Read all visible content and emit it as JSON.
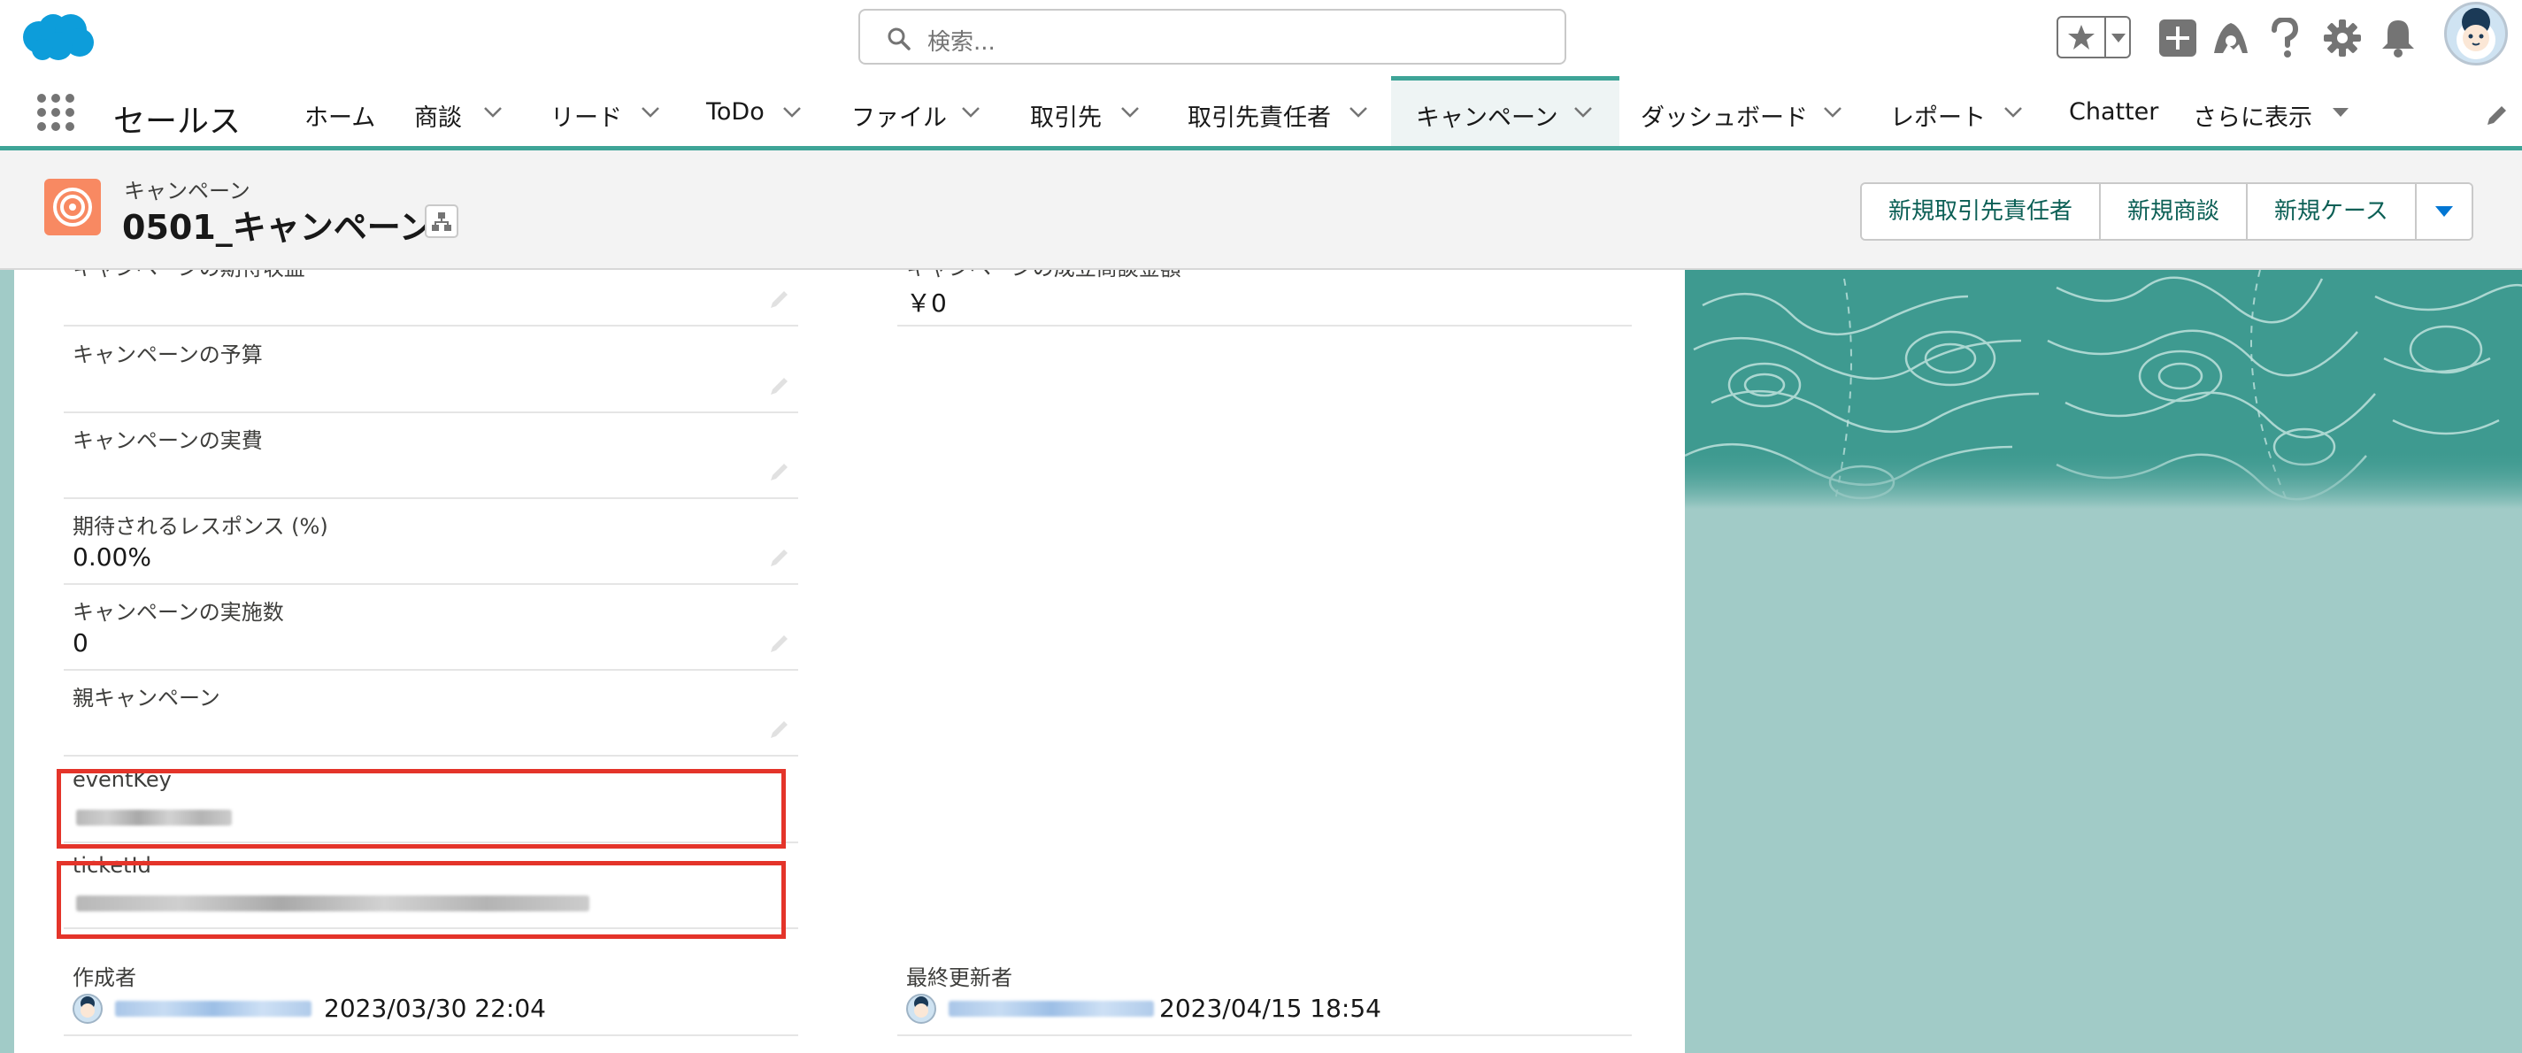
{
  "search": {
    "placeholder": "検索..."
  },
  "nav": {
    "app_name": "セールス",
    "tabs": [
      {
        "label": "ホーム",
        "has_menu": false
      },
      {
        "label": "商談",
        "has_menu": true
      },
      {
        "label": "リード",
        "has_menu": true
      },
      {
        "label": "ToDo",
        "has_menu": true
      },
      {
        "label": "ファイル",
        "has_menu": true
      },
      {
        "label": "取引先",
        "has_menu": true
      },
      {
        "label": "取引先責任者",
        "has_menu": true
      },
      {
        "label": "キャンペーン",
        "has_menu": true,
        "active": true
      },
      {
        "label": "ダッシュボード",
        "has_menu": true
      },
      {
        "label": "レポート",
        "has_menu": true
      },
      {
        "label": "Chatter",
        "has_menu": false
      },
      {
        "label": "さらに表示",
        "has_menu": true
      }
    ]
  },
  "record": {
    "type_label": "キャンペーン",
    "title": "0501_キャンペーン",
    "actions": [
      "新規取引先責任者",
      "新規商談",
      "新規ケース"
    ]
  },
  "fields": {
    "expected_revenue": {
      "label": "キャンペーンの期待収益",
      "value": ""
    },
    "won_amount": {
      "label": "キャンペーンの成立商談金額",
      "value": "￥0"
    },
    "budget": {
      "label": "キャンペーンの予算",
      "value": ""
    },
    "actual_cost": {
      "label": "キャンペーンの実費",
      "value": ""
    },
    "expected_response": {
      "label": "期待されるレスポンス (%)",
      "value": "0.00%"
    },
    "num_sent": {
      "label": "キャンペーンの実施数",
      "value": "0"
    },
    "parent_campaign": {
      "label": "親キャンペーン",
      "value": ""
    },
    "event_key": {
      "label": "eventKey"
    },
    "ticket_id": {
      "label": "ticketId"
    },
    "created_by": {
      "label": "作成者",
      "date": "2023/03/30 22:04"
    },
    "last_modified_by": {
      "label": "最終更新者",
      "date": "2023/04/15 18:54"
    }
  },
  "colors": {
    "brand_teal": "#3ea497",
    "campaign_icon": "#f88962",
    "highlight_red": "#e4342a",
    "button_text": "#0b5f55"
  },
  "icons": [
    "salesforce-cloud-logo",
    "search-icon",
    "star-icon",
    "chevron-down-icon",
    "plus-icon",
    "trailhead-icon",
    "help-icon",
    "gear-icon",
    "bell-icon",
    "avatar",
    "app-launcher-icon",
    "pencil-icon",
    "campaign-target-icon",
    "hierarchy-icon"
  ]
}
